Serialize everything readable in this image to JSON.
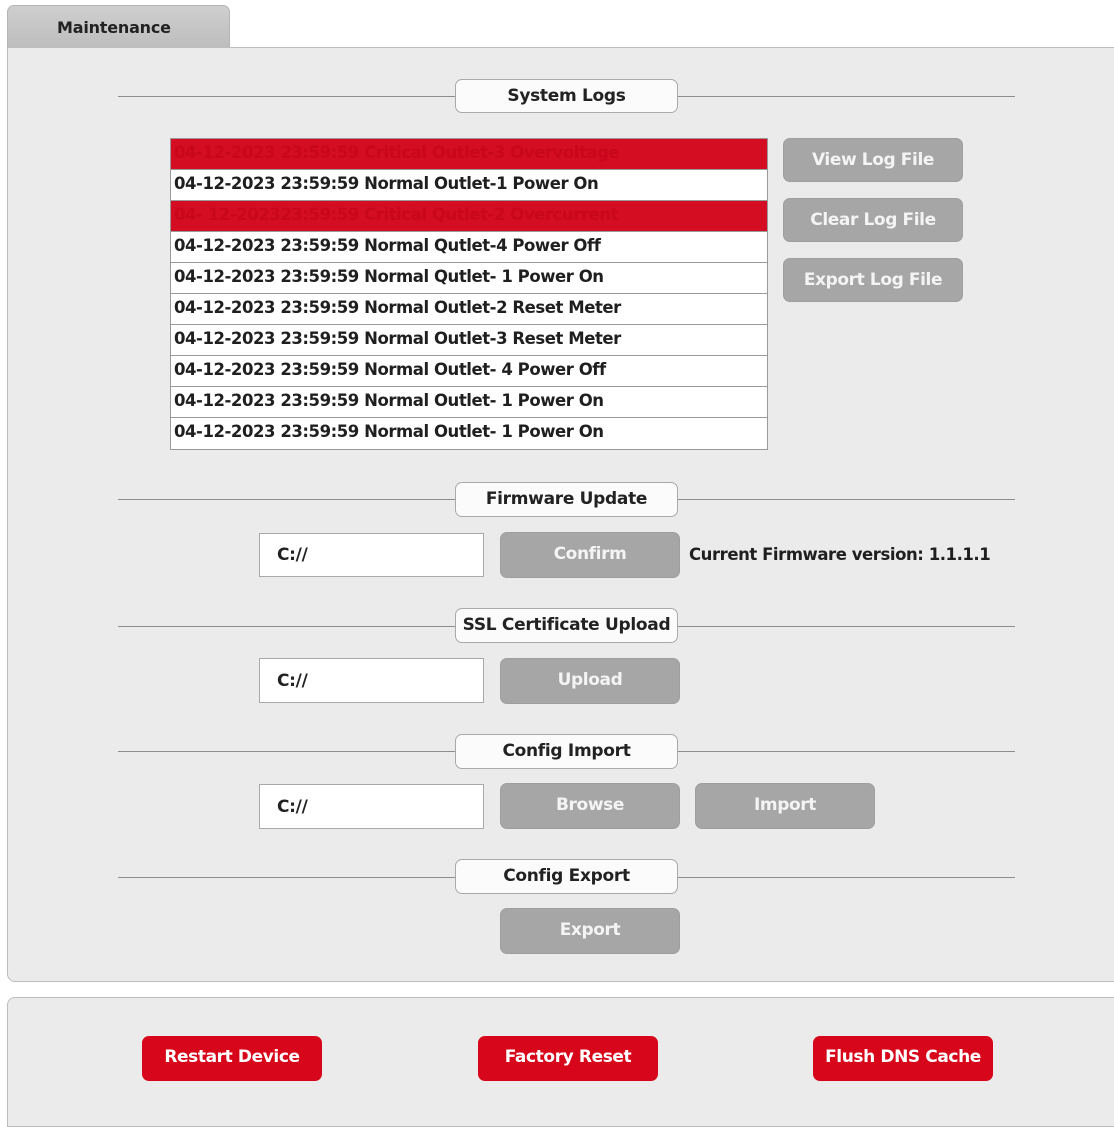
{
  "tab": {
    "label": "Maintenance"
  },
  "system_logs": {
    "title": "System Logs",
    "entries": [
      {
        "text": "04-12-2023 23:59:59 Critical Outlet-3 Overvoltage",
        "level": "critical"
      },
      {
        "text": "04-12-2023 23:59:59 Normal Outlet-1 Power On",
        "level": "normal"
      },
      {
        "text": "04- 12-202323:59:59 Critical Qutlet-2 Overcurrent",
        "level": "critical"
      },
      {
        "text": "04-12-2023 23:59:59 Normal Qutlet-4 Power Off",
        "level": "normal"
      },
      {
        "text": "04-12-2023 23:59:59 Normal Qutlet- 1 Power On",
        "level": "normal"
      },
      {
        "text": "04-12-2023 23:59:59 Normal Outlet-2 Reset Meter",
        "level": "normal"
      },
      {
        "text": "04-12-2023 23:59:59 Normal Outlet-3 Reset Meter",
        "level": "normal"
      },
      {
        "text": "04-12-2023 23:59:59 Normal Outlet- 4 Power Off",
        "level": "normal"
      },
      {
        "text": "04-12-2023 23:59:59 Normal Outlet- 1 Power On",
        "level": "normal"
      },
      {
        "text": "04-12-2023 23:59:59 Normal Outlet- 1 Power On",
        "level": "normal"
      }
    ],
    "buttons": {
      "view": "View Log File",
      "clear": "Clear Log File",
      "export": "Export Log File"
    }
  },
  "firmware_update": {
    "title": "Firmware Update",
    "path_value": "C://",
    "confirm_label": "Confirm",
    "current_version": "Current Firmware version: 1.1.1.1"
  },
  "ssl_upload": {
    "title": "SSL Certificate Upload",
    "path_value": "C://",
    "upload_label": "Upload"
  },
  "config_import": {
    "title": "Config Import",
    "path_value": "C://",
    "browse_label": "Browse",
    "import_label": "Import"
  },
  "config_export": {
    "title": "Config Export",
    "export_label": "Export"
  },
  "device_actions": {
    "restart_label": "Restart Device",
    "factory_reset_label": "Factory Reset",
    "flush_dns_label": "Flush DNS Cache"
  },
  "colors": {
    "critical_row": "#d40d22",
    "action_red": "#d8061b",
    "disabled_gray": "#a6a6a6",
    "panel_bg": "#ebebeb"
  }
}
